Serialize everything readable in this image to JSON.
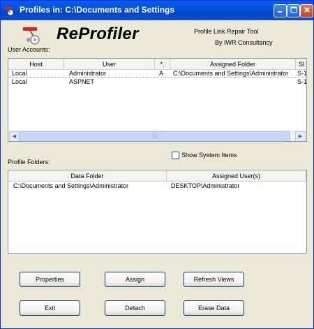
{
  "window": {
    "title": "Profiles in: C:\\Documents and Settings"
  },
  "app": {
    "name": "ReProfiler",
    "tagline1": "Profile Link Repair Tool",
    "tagline2": "By IWR Consultancy"
  },
  "user_accounts": {
    "label": "User Accounts:",
    "columns": [
      "Host",
      "User",
      "*.",
      "Assigned Folder",
      "SI"
    ],
    "rows": [
      {
        "host": "Local",
        "user": "Administrator",
        "star": "A",
        "folder": "C:\\Documents and Settings\\Administrator",
        "sid": "S-1"
      },
      {
        "host": "Local",
        "user": "ASPNET",
        "star": "",
        "folder": "",
        "sid": "S-1"
      }
    ]
  },
  "show_system_items": {
    "label": "Show System Items",
    "checked": false
  },
  "profile_folders": {
    "label": "Profile Folders:",
    "columns": [
      "Data Folder",
      "Assigned User(s)"
    ],
    "rows": [
      {
        "folder": "C:\\Documents and Settings\\Administrator",
        "users": "DESKTOP\\Administrator"
      }
    ]
  },
  "buttons": {
    "properties": "Properties",
    "assign": "Assign",
    "refresh": "Refresh Views",
    "exit": "Exit",
    "detach": "Detach",
    "erase": "Erase Data"
  },
  "icons": {
    "title": "reprofiler-icon",
    "logo": "reprofiler-logo-icon",
    "minimize": "minimize-icon",
    "maximize": "maximize-icon",
    "close": "close-icon"
  },
  "colors": {
    "titlebar": "#0a5bf0",
    "close": "#c4401e",
    "face": "#ece9d8"
  }
}
